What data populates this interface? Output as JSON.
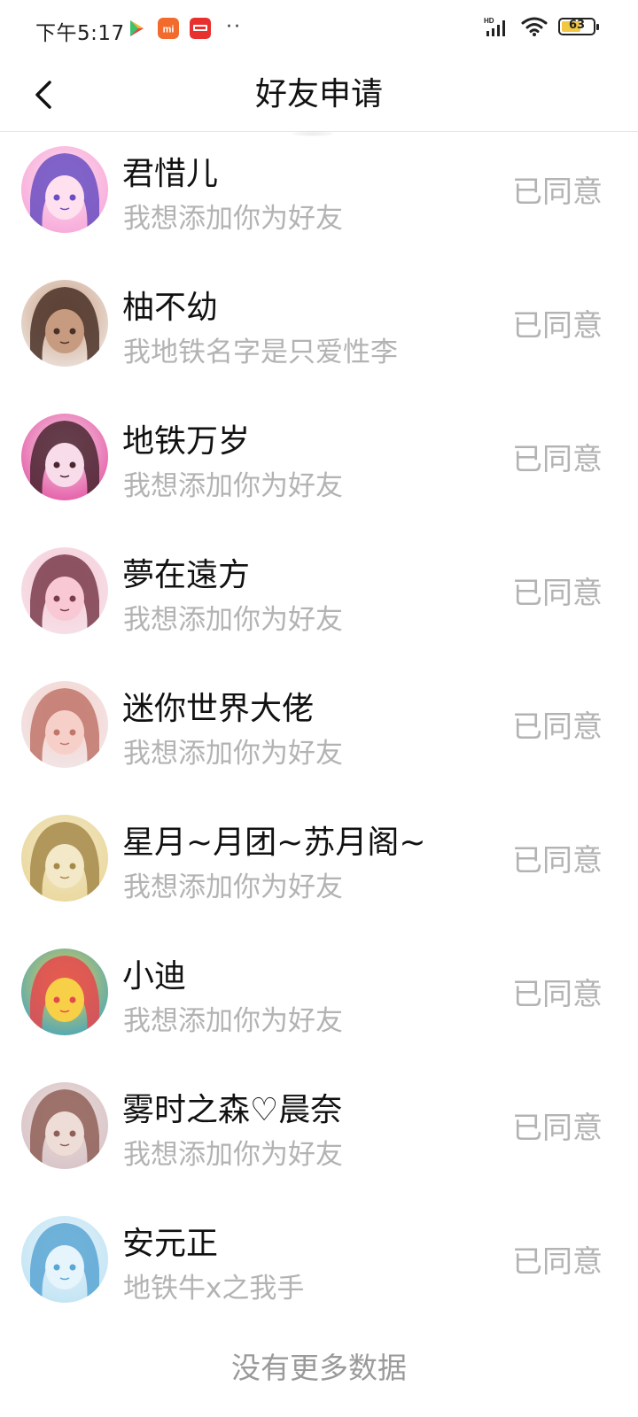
{
  "status_bar": {
    "time": "下午5:17",
    "notification_icons": [
      "play-store-icon",
      "mi-icon",
      "app-red-icon"
    ],
    "more": "··",
    "network": "HD",
    "battery": "63",
    "battery_level": 0.63
  },
  "header": {
    "title": "好友申请"
  },
  "requests": [
    {
      "name": "君惜儿",
      "message": "我想添加你为好友",
      "status": "已同意",
      "avatar_colors": [
        "#f6a3d7",
        "#6a4fc2",
        "#ffe0ef"
      ]
    },
    {
      "name": "柚不幼",
      "message": "我地铁名字是只爱性李",
      "status": "已同意",
      "avatar_colors": [
        "#efe7e2",
        "#4a3128",
        "#c79b7f"
      ]
    },
    {
      "name": "地铁万岁",
      "message": "我想添加你为好友",
      "status": "已同意",
      "avatar_colors": [
        "#e24fa0",
        "#4a2630",
        "#f8dcea"
      ]
    },
    {
      "name": "夢在遠方",
      "message": "我想添加你为好友",
      "status": "已同意",
      "avatar_colors": [
        "#f5e2ea",
        "#7a3c4c",
        "#f8c9d4"
      ]
    },
    {
      "name": "迷你世界大佬",
      "message": "我想添加你为好友",
      "status": "已同意",
      "avatar_colors": [
        "#f1e7ea",
        "#c0766b",
        "#f6d0c8"
      ]
    },
    {
      "name": "星月~月团~苏月阁~",
      "message": "我想添加你为好友",
      "status": "已同意",
      "avatar_colors": [
        "#e9d699",
        "#a68a4a",
        "#f3e8c8"
      ]
    },
    {
      "name": "小迪",
      "message": "我想添加你为好友",
      "status": "已同意",
      "avatar_colors": [
        "#3aa3c4",
        "#e5484d",
        "#f7d048"
      ]
    },
    {
      "name": "雾时之森♡晨奈",
      "message": "我想添加你为好友",
      "status": "已同意",
      "avatar_colors": [
        "#d5c2c8",
        "#8f6058",
        "#eedcd6"
      ]
    },
    {
      "name": "安元正",
      "message": "地铁牛x之我手",
      "status": "已同意",
      "avatar_colors": [
        "#bfe2f3",
        "#5aa6d4",
        "#e6f4fb"
      ]
    }
  ],
  "footer": {
    "no_more_text": "没有更多数据"
  }
}
